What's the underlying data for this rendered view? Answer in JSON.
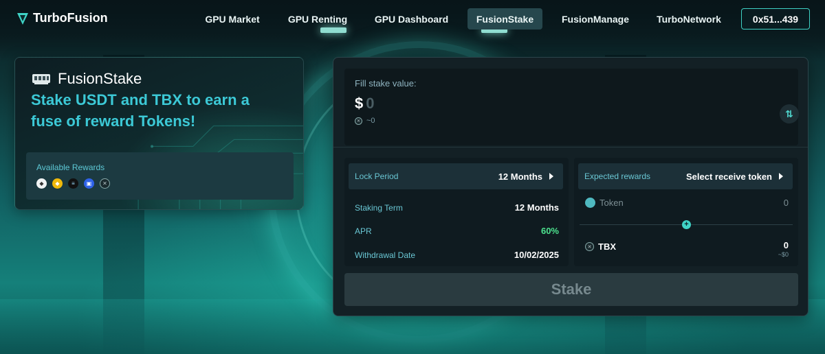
{
  "brand": {
    "name": "TurboFusion"
  },
  "nav": {
    "items": [
      {
        "label": "GPU Market",
        "active": false
      },
      {
        "label": "GPU Renting",
        "active": false
      },
      {
        "label": "GPU Dashboard",
        "active": false
      },
      {
        "label": "FusionStake",
        "active": true
      },
      {
        "label": "FusionManage",
        "active": false
      },
      {
        "label": "TurboNetwork",
        "active": false
      }
    ],
    "wallet": "0x51...439"
  },
  "hero": {
    "title": "FusionStake",
    "headline": "Stake USDT and TBX to earn a fuse of reward Tokens!",
    "rewards_label": "Available Rewards",
    "reward_icons": [
      "ethereum-icon",
      "bnb-icon",
      "solana-icon",
      "blue-token-icon",
      "tbx-icon"
    ]
  },
  "stake": {
    "fill_label": "Fill stake value:",
    "currency_symbol": "$",
    "amount": "0",
    "approx": "~0",
    "lock_period": {
      "label": "Lock Period",
      "value": "12 Months"
    },
    "staking_term": {
      "label": "Staking Term",
      "value": "12 Months"
    },
    "apr": {
      "label": "APR",
      "value": "60%"
    },
    "withdrawal_date": {
      "label": "Withdrawal Date",
      "value": "10/02/2025"
    },
    "expected_rewards": {
      "label": "Expected rewards",
      "select": "Select receive token"
    },
    "token_row": {
      "name": "Token",
      "value": "0"
    },
    "tbx_row": {
      "name": "TBX",
      "value": "0",
      "usd": "~$0"
    },
    "button": "Stake"
  },
  "colors": {
    "accent": "#3fd3c6",
    "headline": "#3cc9d6",
    "apr_green": "#4de38f"
  }
}
